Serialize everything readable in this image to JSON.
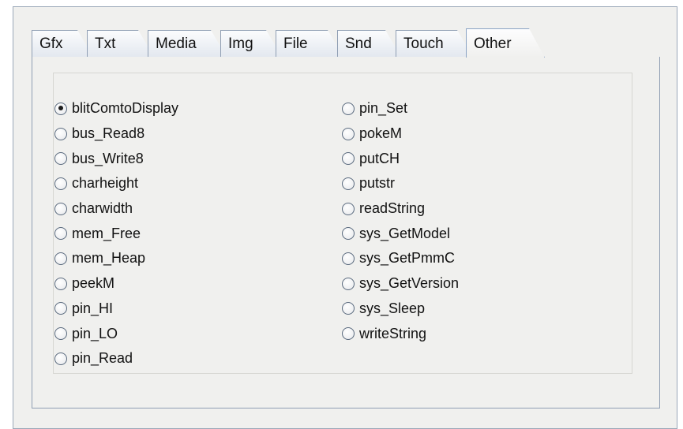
{
  "tabs": [
    {
      "label": "Gfx"
    },
    {
      "label": "Txt"
    },
    {
      "label": "Media"
    },
    {
      "label": "Img"
    },
    {
      "label": "File"
    },
    {
      "label": "Snd"
    },
    {
      "label": "Touch"
    },
    {
      "label": "Other",
      "active": true
    }
  ],
  "options": {
    "selected": "blitComtoDisplay",
    "left": [
      {
        "label": "blitComtoDisplay"
      },
      {
        "label": "bus_Read8"
      },
      {
        "label": "bus_Write8"
      },
      {
        "label": "charheight"
      },
      {
        "label": "charwidth"
      },
      {
        "label": "mem_Free"
      },
      {
        "label": "mem_Heap"
      },
      {
        "label": "peekM"
      },
      {
        "label": "pin_HI"
      },
      {
        "label": "pin_LO"
      },
      {
        "label": "pin_Read"
      }
    ],
    "right": [
      {
        "label": "pin_Set"
      },
      {
        "label": "pokeM"
      },
      {
        "label": "putCH"
      },
      {
        "label": "putstr"
      },
      {
        "label": "readString"
      },
      {
        "label": "sys_GetModel"
      },
      {
        "label": "sys_GetPmmC"
      },
      {
        "label": "sys_GetVersion"
      },
      {
        "label": "sys_Sleep"
      },
      {
        "label": "writeString"
      }
    ]
  }
}
